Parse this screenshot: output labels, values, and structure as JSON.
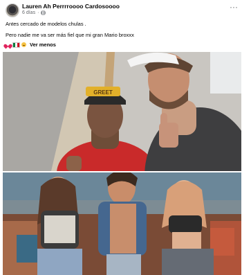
{
  "post": {
    "author": "Lauren Ah Perrrroooo Cardosoooo",
    "time": "6 días",
    "privacy_icon": "globe-icon",
    "more_icon": "more-options-icon"
  },
  "caption": {
    "line1": "Antes cercado de modelos chulas .",
    "line2": "Pero nadie me va ser más fiel que mi gran Mario broxxx",
    "emojis": [
      "heart-emoji",
      "mexico-flag-emoji",
      "laughing-face-emoji"
    ],
    "see_more": "Ver menos"
  },
  "photos": {
    "top_photo_caption": "",
    "cap_text": "GREET"
  },
  "colors": {
    "text": "#050505",
    "meta": "#65676b",
    "red_shirt": "#c92a2a",
    "hat_yellow": "#e2b02a"
  }
}
